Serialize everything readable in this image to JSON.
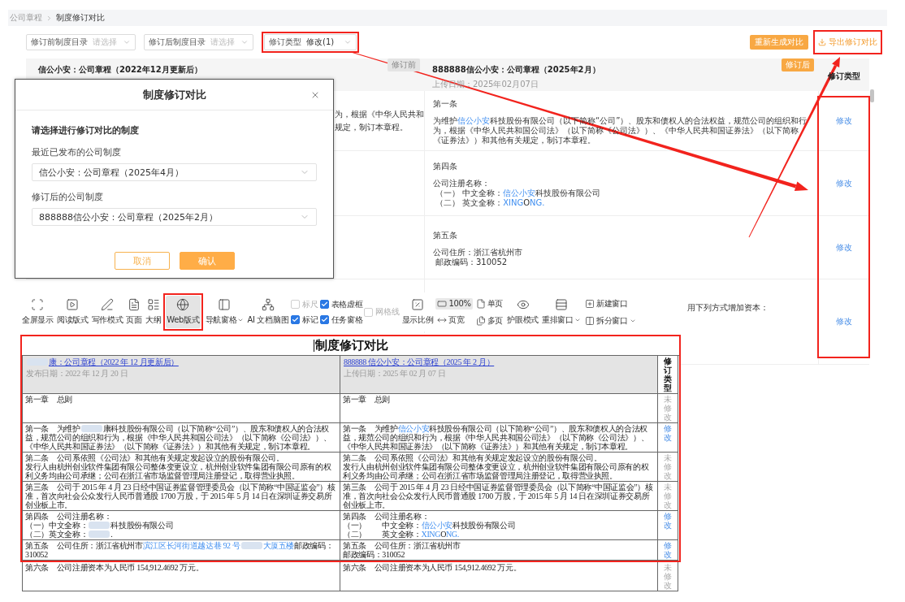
{
  "breadcrumb": [
    "公司章程",
    "制度修订对比"
  ],
  "filters": [
    {
      "label": "修订前制度目录",
      "placeholder": "请选择"
    },
    {
      "label": "修订后制度目录",
      "placeholder": "请选择"
    },
    {
      "label": "修订类型",
      "value": "修改(1)"
    }
  ],
  "actions": [
    {
      "label": "重新生成对比",
      "kind": "primary"
    },
    {
      "label": "导出修订对比",
      "kind": "export"
    }
  ],
  "comparison": {
    "columns": [
      {
        "title": "信公小安：公司章程（2022年12月更新后）",
        "badge": "修订前"
      },
      {
        "title": "888888信公小安：公司章程（2025年2月）",
        "date": "上传日期：2025年02月07日",
        "badge": "修订后"
      }
    ],
    "type_header": "修订类型",
    "rows": [
      {
        "before": [
          "为，根据《中华人民共和",
          "规定，制订本章程。"
        ],
        "after": {
          "heading": "第一条",
          "paragraphs": [
            [
              {
                "kind": "plain",
                "text": "为维护"
              },
              {
                "kind": "changed",
                "text": "信公小安"
              },
              {
                "kind": "plain",
                "text": "科技股份有限公司（以下简称“公司”）、股东和债权人的合法权益，规范公司的组织和行为，根据《中华人民共和国公司法》（以下简称《公司法》）、《中华人民共和国证券法》（以下简称《证券法》）和其他有关规定，制订本章程。"
              }
            ]
          ]
        },
        "type": "修改"
      },
      {
        "after": {
          "heading": "第四条",
          "paragraphs": [
            "公司注册名称：",
            [
              {
                "kind": "plain",
                "text": "（一） 中文全称："
              },
              {
                "kind": "changed",
                "text": "信公小安"
              },
              {
                "kind": "plain",
                "text": "科技股份有限公司"
              }
            ],
            [
              {
                "kind": "plain",
                "text": "（二） 英文全称："
              },
              {
                "kind": "changed",
                "text": "XING"
              },
              {
                "kind": "plain",
                "text": "O"
              },
              {
                "kind": "changed",
                "text": "NG."
              }
            ]
          ]
        },
        "type": "修改"
      },
      {
        "after": {
          "heading": "第五条",
          "paragraphs": [
            "公司住所：浙江省杭州市",
            "邮政编码：310052"
          ]
        },
        "type": "修改"
      },
      {
        "after": {
          "paragraphs": [
            "用下列方式增加资本："
          ]
        },
        "type": "修改"
      }
    ]
  },
  "dialog": {
    "title": "制度修订对比",
    "prompt": "请选择进行修订对比的制度",
    "fields": [
      {
        "label": "最近已发布的公司制度",
        "value": "信公小安：公司章程（2025年4月）"
      },
      {
        "label": "修订后的公司制度",
        "value": "888888信公小安：公司章程（2025年2月）"
      }
    ],
    "buttons": [
      {
        "label": "取消",
        "kind": "secondary"
      },
      {
        "label": "确认",
        "kind": "primary"
      }
    ]
  },
  "toolbar": {
    "groups": [
      {
        "kind": "large",
        "label": "全屏显示",
        "selected": false,
        "dropdown": false
      },
      {
        "kind": "large",
        "label": "阅读版式",
        "selected": false,
        "dropdown": false
      },
      {
        "kind": "large",
        "label": "写作模式",
        "selected": false,
        "dropdown": false
      },
      {
        "kind": "large",
        "label": "页面",
        "selected": false,
        "dropdown": false
      },
      {
        "kind": "large",
        "label": "大纲",
        "selected": false,
        "dropdown": false
      },
      {
        "kind": "large",
        "label": "Web版式",
        "selected": true,
        "dropdown": false
      },
      {
        "kind": "large",
        "label": "导航窗格",
        "selected": false,
        "dropdown": true
      },
      {
        "kind": "large",
        "label": "AI 文档脑图",
        "selected": false,
        "dropdown": false
      },
      {
        "kind": "stack",
        "items": [
          {
            "kind": "checkbox",
            "label": "标尺",
            "checked": false,
            "disabled": true
          },
          {
            "kind": "checkbox",
            "label": "标记",
            "checked": true,
            "disabled": false
          }
        ]
      },
      {
        "kind": "stack",
        "items": [
          {
            "kind": "checkbox",
            "label": "表格虚框",
            "checked": true,
            "disabled": false
          },
          {
            "kind": "checkbox",
            "label": "任务窗格",
            "checked": true,
            "disabled": false
          }
        ]
      },
      {
        "kind": "stack",
        "items": [
          {
            "kind": "checkbox",
            "label": "网格线",
            "checked": false,
            "disabled": true
          }
        ]
      },
      {
        "kind": "large",
        "label": "显示比例",
        "selected": false,
        "dropdown": false
      },
      {
        "kind": "stack",
        "items": [
          {
            "kind": "small",
            "label": "100%",
            "selected": true,
            "dropdown": false
          },
          {
            "kind": "small",
            "label": "页宽",
            "selected": false,
            "dropdown": false
          }
        ]
      },
      {
        "kind": "stack",
        "items": [
          {
            "kind": "small",
            "label": "单页",
            "selected": false,
            "dropdown": false
          },
          {
            "kind": "small",
            "label": "多页",
            "selected": false,
            "dropdown": false
          }
        ]
      },
      {
        "kind": "large",
        "label": "护眼模式",
        "selected": false,
        "dropdown": false
      },
      {
        "kind": "large",
        "label": "重排窗口",
        "selected": false,
        "dropdown": true
      },
      {
        "kind": "stack",
        "items": [
          {
            "kind": "small",
            "label": "新建窗口",
            "selected": false,
            "dropdown": false
          },
          {
            "kind": "small",
            "label": "拆分窗口",
            "selected": false,
            "dropdown": true
          }
        ]
      }
    ]
  },
  "document": {
    "title": "制度修订对比",
    "columns": [
      {
        "title": [
          {
            "kind": "redacted"
          },
          {
            "kind": "plain",
            "text": "康：公司章程（2022 年 12 月更新后）"
          }
        ],
        "date": "发布日期：2022 年 12 月 20 日"
      },
      {
        "title": "888888 信公小安：公司章程（2025 年 2 月）",
        "date": "上传日期：2025 年 02 月 07 日"
      }
    ],
    "type_header": "修订类型",
    "rows": [
      {
        "before": [
          "第一章　总则"
        ],
        "after": [
          "第一章　总则"
        ],
        "type": "未修改",
        "modified": false
      },
      {
        "before": [
          [
            {
              "kind": "plain",
              "text": "第一条　为维护"
            },
            {
              "kind": "redacted"
            },
            {
              "kind": "plain",
              "text": "康科技股份有限公司（以下简称“公司”）、股东和债权人的合法权益，规范公司的组织和行为，根据《中华人民共和国公司法》（以下简称《公司法》）、《中华人民共和国证券法》（以下简称《证券法》）和其他有关规定，制订本章程。"
            }
          ]
        ],
        "after": [
          [
            {
              "kind": "plain",
              "text": "第一条　为维护"
            },
            {
              "kind": "changed",
              "text": "信公小安"
            },
            {
              "kind": "plain",
              "text": "科技股份有限公司（以下简称“公司”）、股东和债权人的合法权益，规范公司的组织和行为，根据《中华人民共和国公司法》（以下简称《公司法》）、《中华人民共和国证券法》（以下简称《证券法》）和其他有关规定，制订本章程。"
            }
          ]
        ],
        "type": "修改",
        "modified": true
      },
      {
        "before": [
          "第二条　公司系依照《公司法》和其他有关规定发起设立的股份有限公司。",
          "发行人由杭州创业软件集团有限公司整体变更设立，杭州创业软件集团有限公司原有的权利义务均由公司承继；公司在浙江省市场监督管理局注册登记，取得营业执照。"
        ],
        "after": [
          "第二条　公司系依照《公司法》和其他有关规定发起设立的股份有限公司。",
          "发行人由杭州创业软件集团有限公司整体变更设立，杭州创业软件集团有限公司原有的权利义务均由公司承继；公司在浙江省市场监督管理局注册登记，取得营业执照。"
        ],
        "type": "未修改",
        "modified": false
      },
      {
        "before": [
          "第三条　公司于 2015 年 4 月 23 日经中国证券监督管理委员会（以下简称“中国证监会”）核准，首次向社会公众发行人民币普通股 1700 万股，于 2015 年 5 月 14 日在深圳证券交易所创业板上市。"
        ],
        "after": [
          "第三条　公司于 2015 年 4 月 23 日经中国证券监督管理委员会（以下简称“中国证监会”）核准，首次向社会公众发行人民币普通股 1700 万股，于 2015 年 5 月 14 日在深圳证券交易所创业板上市。"
        ],
        "type": "未修改",
        "modified": false
      },
      {
        "before": [
          "第四条　公司注册名称：",
          [
            {
              "kind": "plain",
              "text": "（一）中文全称："
            },
            {
              "kind": "redacted"
            },
            {
              "kind": "plain",
              "text": "科技股份有限公司"
            }
          ],
          [
            {
              "kind": "plain",
              "text": "（二）英文全称："
            },
            {
              "kind": "redacted"
            },
            {
              "kind": "plain",
              "text": "."
            }
          ]
        ],
        "after": [
          "第四条　公司注册名称：",
          [
            {
              "kind": "plain",
              "text": "（一）　　中文全称："
            },
            {
              "kind": "changed",
              "text": "信公小安"
            },
            {
              "kind": "plain",
              "text": "科技股份有限公司"
            }
          ],
          [
            {
              "kind": "plain",
              "text": "（二）　　英文全称："
            },
            {
              "kind": "changed",
              "text": "XING"
            },
            {
              "kind": "plain",
              "text": "O"
            },
            {
              "kind": "changed",
              "text": "NG."
            }
          ]
        ],
        "type": "修改",
        "modified": true
      },
      {
        "before": [
          [
            {
              "kind": "plain",
              "text": "第五条　公司住所：浙江省杭州市"
            },
            {
              "kind": "changed",
              "text": "滨江区长河街道越达巷 92 号"
            },
            {
              "kind": "redacted"
            },
            {
              "kind": "changed",
              "text": "大厦五楼"
            },
            {
              "kind": "plain",
              "text": "邮政编码：310052"
            }
          ]
        ],
        "after": [
          "第五条　公司住所：浙江省杭州市",
          "邮政编码：310052"
        ],
        "type": "修改",
        "modified": true
      },
      {
        "before": [
          "第六条　公司注册资本为人民币 154,912.4692 万元。"
        ],
        "after": [
          "第六条　公司注册资本为人民币 154,912.4692 万元。"
        ],
        "type": "未修改",
        "modified": false
      }
    ]
  }
}
